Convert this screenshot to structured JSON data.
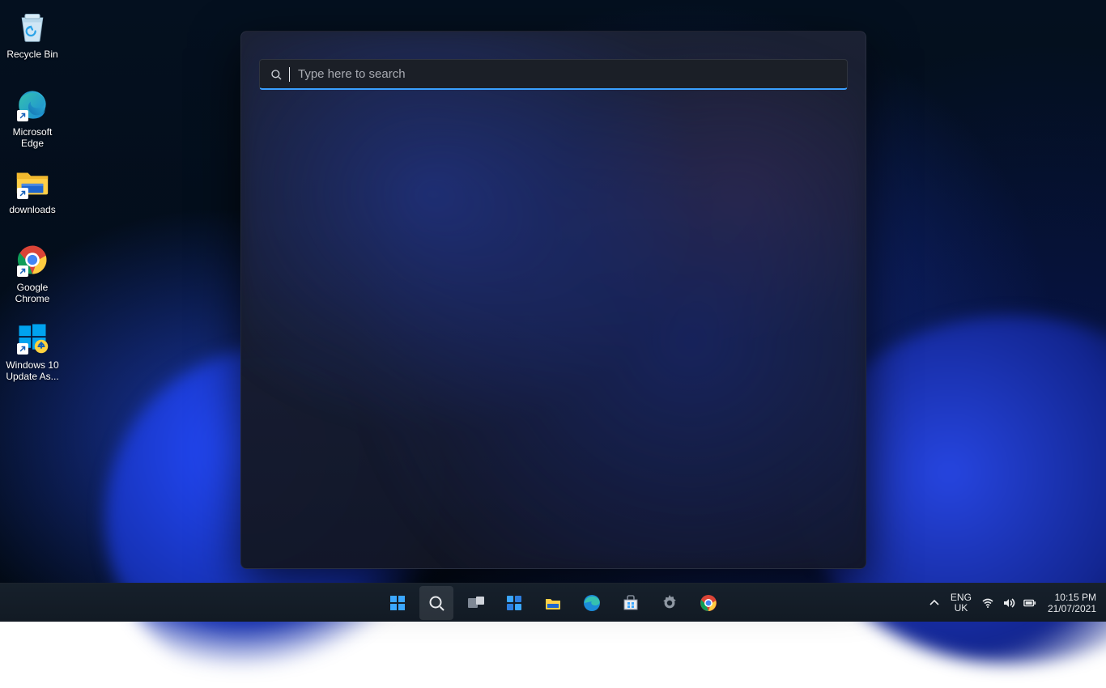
{
  "desktop_icons": [
    {
      "id": "recycle-bin",
      "label": "Recycle Bin",
      "shortcut": false
    },
    {
      "id": "microsoft-edge",
      "label": "Microsoft Edge",
      "shortcut": true
    },
    {
      "id": "downloads",
      "label": "downloads",
      "shortcut": true
    },
    {
      "id": "google-chrome",
      "label": "Google Chrome",
      "shortcut": true
    },
    {
      "id": "win10-update",
      "label": "Windows 10 Update As...",
      "shortcut": true
    }
  ],
  "search": {
    "placeholder": "Type here to search",
    "value": ""
  },
  "taskbar": {
    "items": [
      {
        "id": "start",
        "name": "start-button",
        "active": false
      },
      {
        "id": "search",
        "name": "taskbar-search",
        "active": true
      },
      {
        "id": "task-view",
        "name": "task-view-button",
        "active": false
      },
      {
        "id": "widgets",
        "name": "widgets-button",
        "active": false
      },
      {
        "id": "file-explorer",
        "name": "file-explorer-button",
        "active": false
      },
      {
        "id": "edge",
        "name": "edge-button",
        "active": false
      },
      {
        "id": "store",
        "name": "store-button",
        "active": false
      },
      {
        "id": "settings",
        "name": "settings-button",
        "active": false
      },
      {
        "id": "chrome",
        "name": "chrome-button",
        "active": false
      }
    ]
  },
  "systray": {
    "language_line1": "ENG",
    "language_line2": "UK",
    "time": "10:15 PM",
    "date": "21/07/2021"
  }
}
